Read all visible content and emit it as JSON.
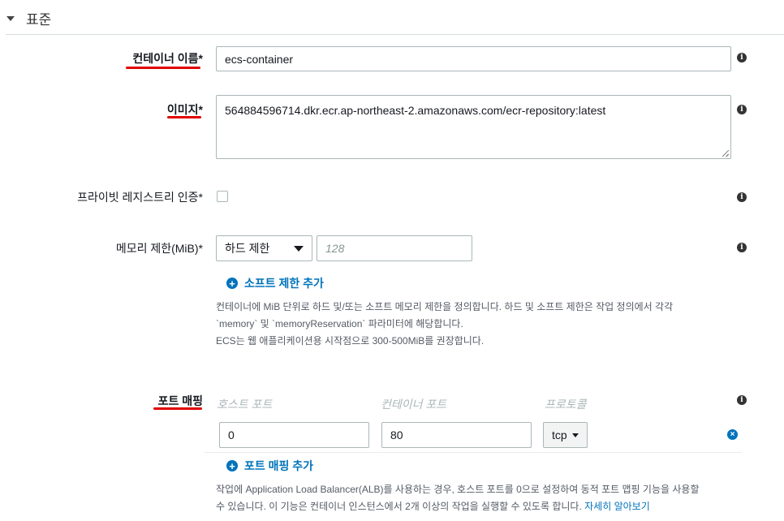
{
  "section": {
    "title": "표준"
  },
  "container_name": {
    "label": "컨테이너 이름",
    "required": "*",
    "value": "ecs-container"
  },
  "image": {
    "label": "이미지",
    "required": "*",
    "value": "564884596714.dkr.ecr.ap-northeast-2.amazonaws.com/ecr-repository:latest"
  },
  "private_registry": {
    "label": "프라이빗 레지스트리 인증",
    "required": "*",
    "checked": false
  },
  "memory": {
    "label": "메모리 제한(MiB)",
    "required": "*",
    "limit_type": "하드 제한",
    "placeholder": "128",
    "add_soft_limit": "소프트 제한 추가",
    "help_line1": "컨테이너에 MiB 단위로 하드 및/또는 소프트 메모리 제한을 정의합니다. 하드 및 소프트 제한은 작업 정의에서 각각",
    "help_line2": "`memory` 및 `memoryReservation` 파라미터에 해당합니다.",
    "help_line3": "ECS는 웹 애플리케이션용 시작점으로 300-500MiB를 권장합니다."
  },
  "port_mapping": {
    "label": "포트 매핑",
    "columns": {
      "host_port": "호스트 포트",
      "container_port": "컨테이너 포트",
      "protocol": "프로토콜"
    },
    "rows": [
      {
        "host_port": "0",
        "container_port": "80",
        "protocol": "tcp"
      }
    ],
    "add_label": "포트 매핑 추가",
    "help_line1": "작업에 Application Load Balancer(ALB)를 사용하는 경우, 호스트 포트를 0으로 설정하여 동적 포트 맵핑 기능을 사용할",
    "help_line2": "수 있습니다. 이 기능은 컨테이너 인스턴스에서 2개 이상의 작업을 실행할 수 있도록 합니다.",
    "help_link": "자세히 알아보기"
  },
  "icons": {
    "info": "info-icon",
    "plus": "plus-circle-icon",
    "remove": "remove-circle-icon",
    "caret": "caret-down-icon"
  },
  "colors": {
    "link": "#0073bb",
    "annotation": "#e00000",
    "border": "#aab7b8"
  }
}
